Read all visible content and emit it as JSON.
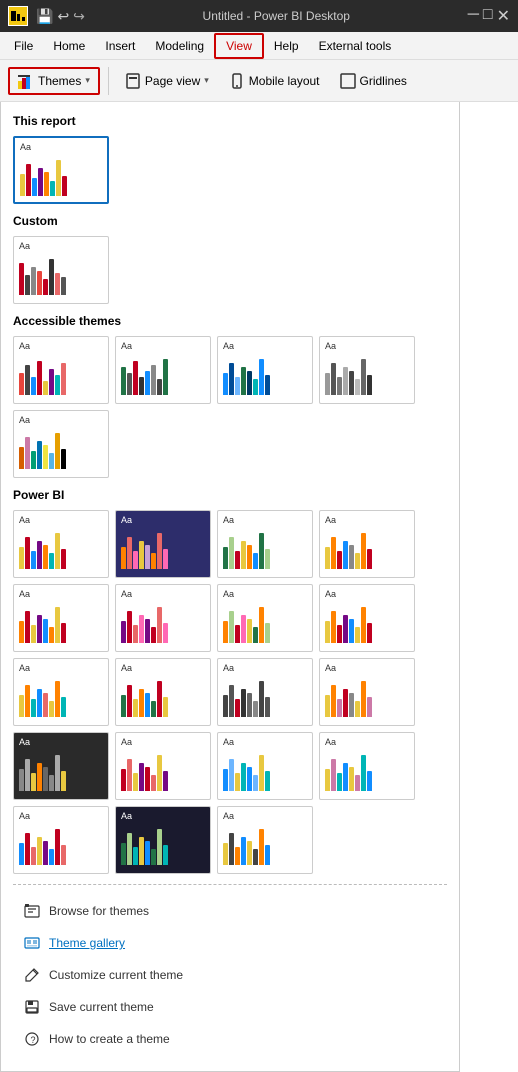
{
  "titlebar": {
    "title": "Untitled - Power BI Desktop",
    "save_icon": "💾",
    "undo_icon": "↩",
    "redo_icon": "↪"
  },
  "menubar": {
    "items": [
      {
        "label": "File",
        "active": false
      },
      {
        "label": "Home",
        "active": false
      },
      {
        "label": "Insert",
        "active": false
      },
      {
        "label": "Modeling",
        "active": false
      },
      {
        "label": "View",
        "active": true,
        "highlighted": true
      },
      {
        "label": "Help",
        "active": false
      },
      {
        "label": "External tools",
        "active": false
      }
    ]
  },
  "ribbon": {
    "themes_label": "Themes",
    "page_view_label": "Page view",
    "mobile_layout_label": "Mobile layout",
    "gridlines_label": "Gridlines"
  },
  "themes_panel": {
    "this_report_label": "This report",
    "custom_label": "Custom",
    "accessible_themes_label": "Accessible themes",
    "power_bi_label": "Power BI"
  },
  "bottom_menu": {
    "items": [
      {
        "label": "Browse for themes",
        "icon": "📂"
      },
      {
        "label": "Theme gallery",
        "icon": "🖼",
        "link": true
      },
      {
        "label": "Customize current theme",
        "icon": "✏"
      },
      {
        "label": "Save current theme",
        "icon": "💾"
      },
      {
        "label": "How to create a theme",
        "icon": "❓"
      }
    ]
  }
}
